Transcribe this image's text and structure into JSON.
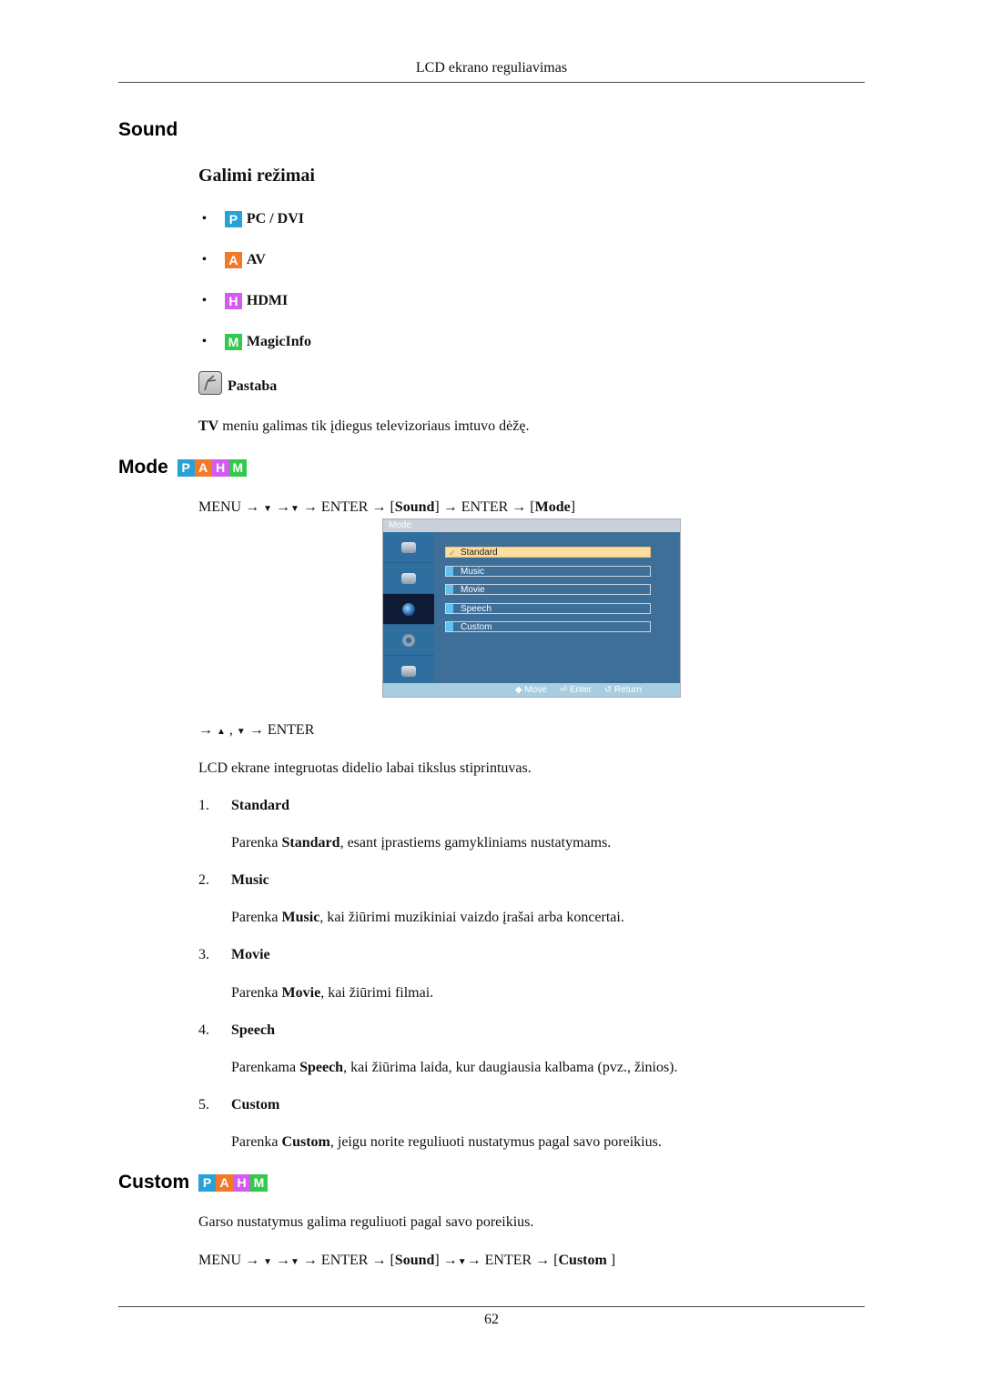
{
  "header": {
    "running_title": "LCD ekrano reguliavimas"
  },
  "sound_section": {
    "title": "Sound",
    "subtitle": "Galimi režimai",
    "modes": [
      {
        "badge": "P",
        "color": "#2aa0d8",
        "label": "PC / DVI"
      },
      {
        "badge": "A",
        "color": "#f07a28",
        "label": "AV"
      },
      {
        "badge": "H",
        "color": "#d35cf0",
        "label": "HDMI"
      },
      {
        "badge": "M",
        "color": "#33c94a",
        "label": "MagicInfo"
      }
    ],
    "note": {
      "icon": "note-pencil-icon",
      "label": "Pastaba",
      "text_bold": "TV",
      "text_rest": " meniu galimas tik įdiegus televizoriaus imtuvo dėžę."
    }
  },
  "mode_section": {
    "title": "Mode",
    "badges": [
      "P",
      "A",
      "H",
      "M"
    ],
    "path": {
      "p1": "MENU → ",
      "t1": "▼",
      "p2": " →",
      "t2": "▼",
      "p3": " → ENTER → [",
      "sound": "Sound",
      "p4": "] → ENTER → [",
      "mode": "Mode",
      "p5": "]"
    },
    "osd": {
      "title": "Mode",
      "items": [
        "Standard",
        "Music",
        "Movie",
        "Speech",
        "Custom"
      ],
      "selected": "Standard",
      "check": "✓",
      "footer": {
        "move": "◆ Move",
        "enter": "⏎ Enter",
        "return": "↺ Return"
      }
    },
    "nav": {
      "p1": "→ ",
      "up": "▲",
      "sep": " , ",
      "down": "▼",
      "p2": " → ENTER"
    },
    "intro": "LCD ekrane integruotas didelio labai tikslus stiprintuvas.",
    "options": [
      {
        "num": "1.",
        "name": "Standard",
        "pre": "Parenka ",
        "bold": "Standard",
        "post": ", esant įprastiems gamykliniams nustatymams."
      },
      {
        "num": "2.",
        "name": "Music",
        "pre": "Parenka ",
        "bold": "Music",
        "post": ", kai žiūrimi muzikiniai vaizdo įrašai arba koncertai."
      },
      {
        "num": "3.",
        "name": "Movie",
        "pre": "Parenka ",
        "bold": "Movie",
        "post": ", kai žiūrimi filmai."
      },
      {
        "num": "4.",
        "name": "Speech",
        "pre": "Parenkama ",
        "bold": "Speech",
        "post": ", kai žiūrima laida, kur daugiausia kalbama (pvz., žinios)."
      },
      {
        "num": "5.",
        "name": "Custom",
        "pre": "Parenka ",
        "bold": "Custom",
        "post": ", jeigu norite reguliuoti nustatymus pagal savo poreikius."
      }
    ]
  },
  "custom_section": {
    "title": "Custom",
    "badges": [
      "P",
      "A",
      "H",
      "M"
    ],
    "intro": "Garso nustatymus galima reguliuoti pagal savo poreikius.",
    "path": {
      "p1": "MENU → ",
      "t1": "▼",
      "p2": " →",
      "t2": "▼",
      "p3": " → ENTER → [",
      "sound": "Sound",
      "p4": "] →",
      "t3": "▼",
      "p5": "→ ENTER → [",
      "custom": "Custom",
      "p6": " ]"
    }
  },
  "footer": {
    "page_number": "62"
  },
  "colors": {
    "P": "#2aa0d8",
    "A": "#f07a28",
    "H": "#d35cf0",
    "M": "#33c94a"
  }
}
